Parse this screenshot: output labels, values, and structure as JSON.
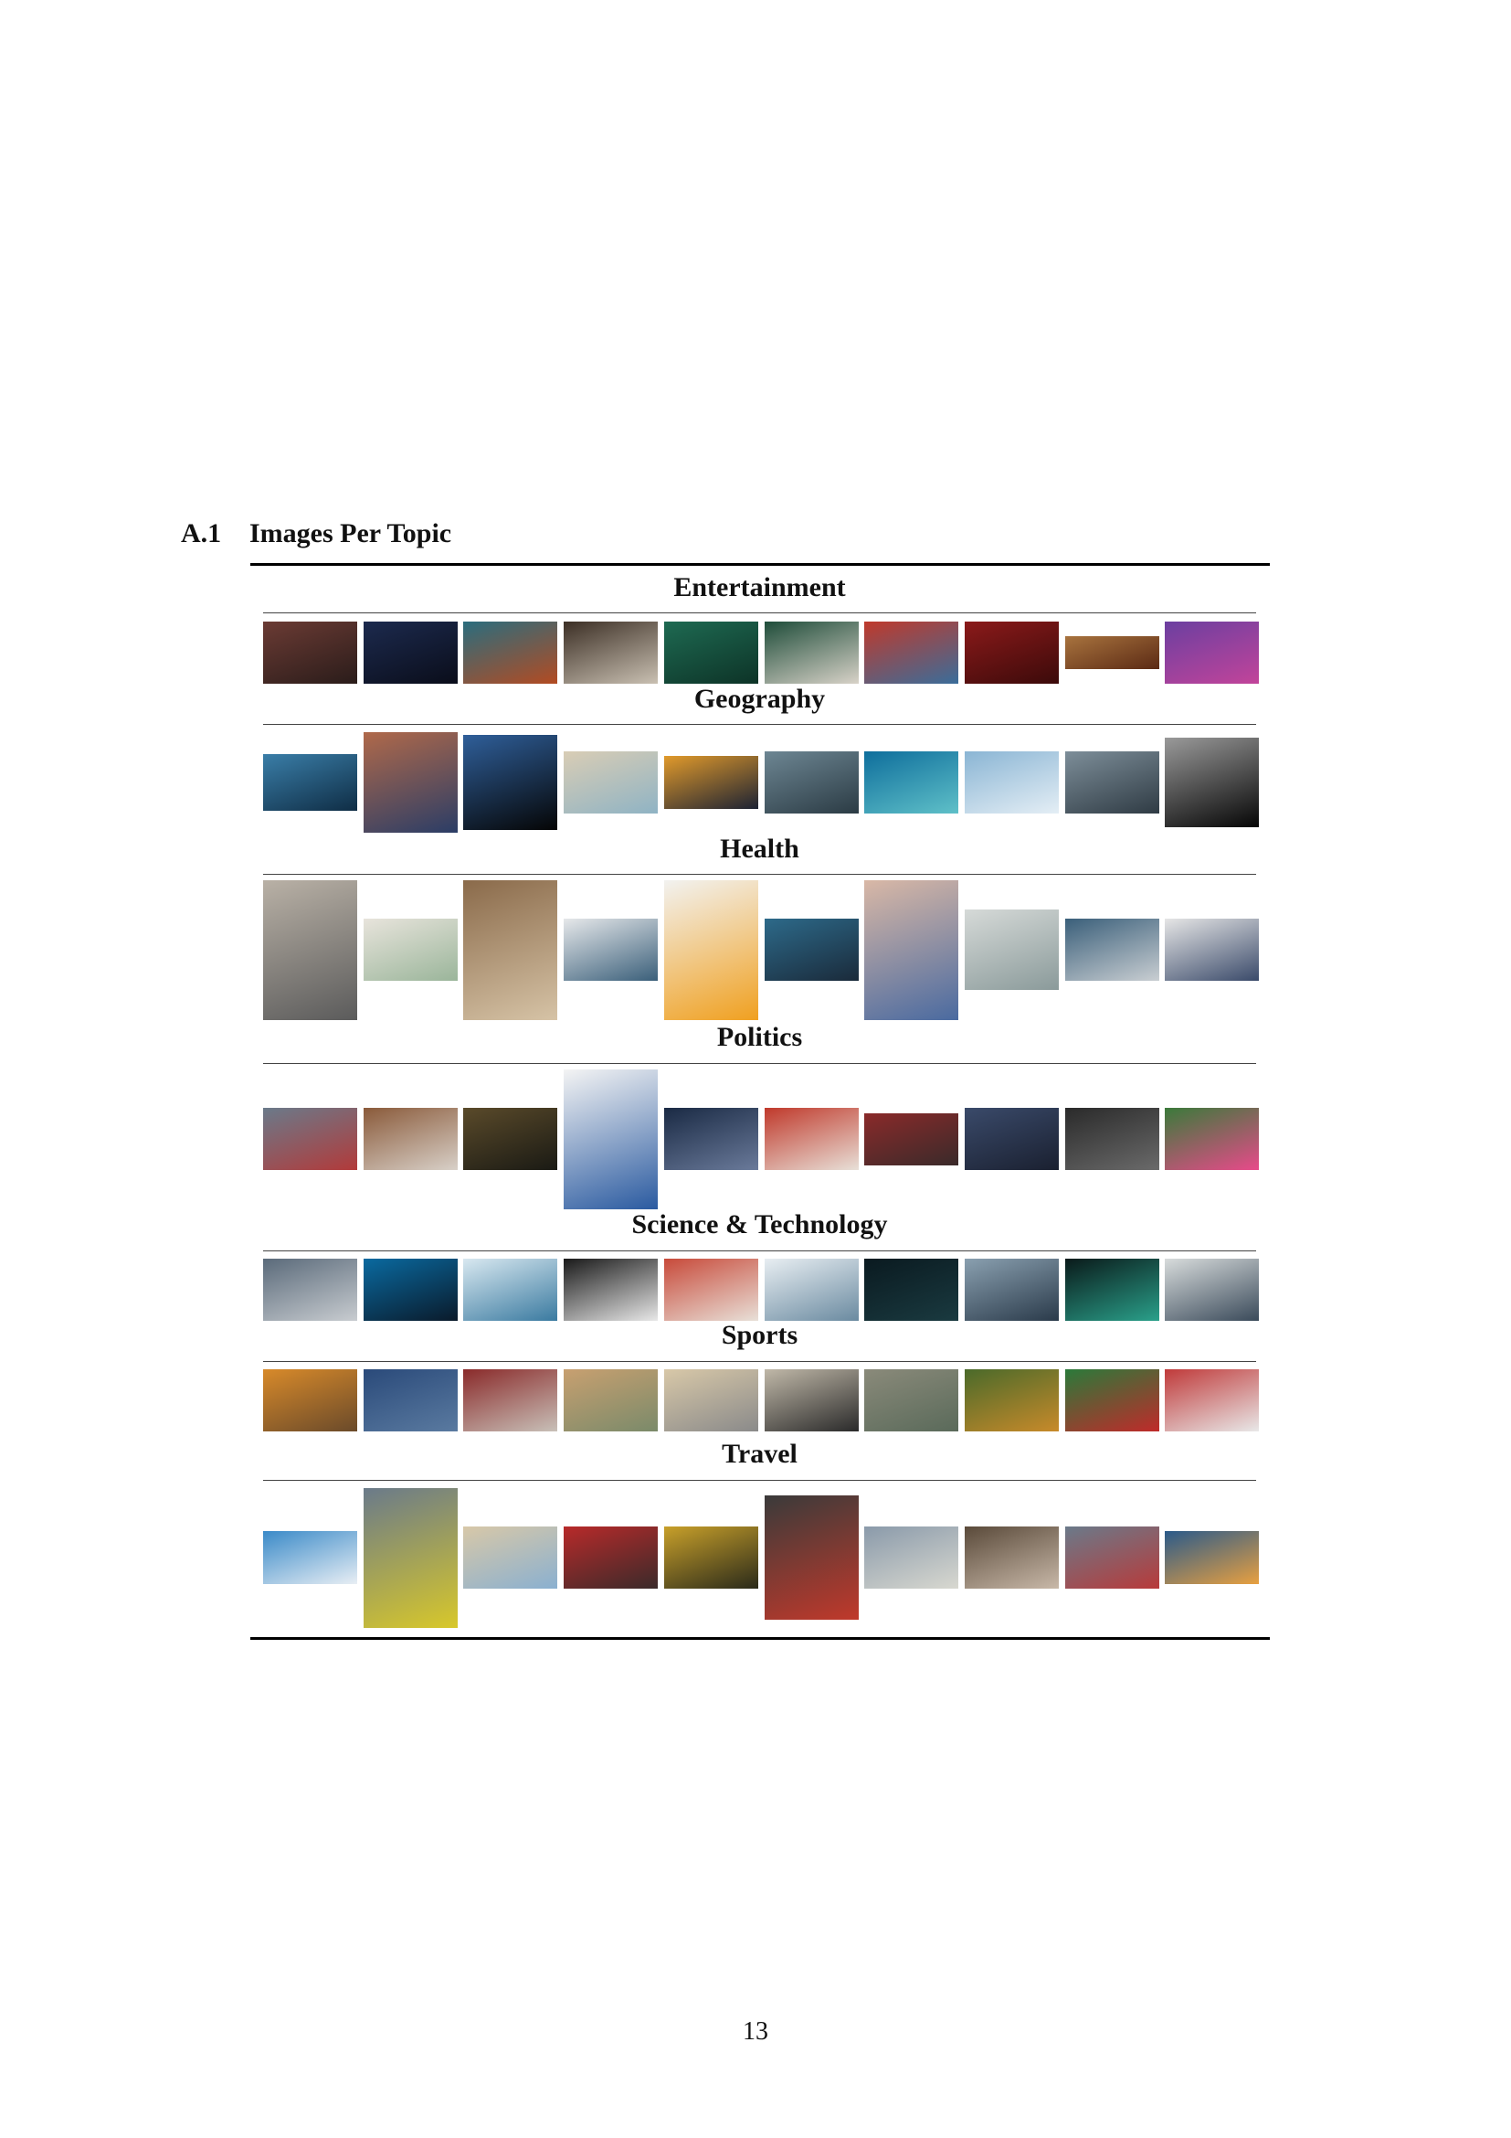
{
  "section": {
    "number": "A.1",
    "title": "Images Per Topic"
  },
  "topics": [
    {
      "title": "Entertainment",
      "images": [
        {
          "icon": "photo-crowd-hall",
          "c": [
            "#6b3b34",
            "#2a1c1a"
          ]
        },
        {
          "icon": "photo-concert-lights",
          "c": [
            "#1c2a4e",
            "#0a0d1a"
          ]
        },
        {
          "icon": "photo-swing-ride",
          "c": [
            "#2a6d7e",
            "#b34b22"
          ]
        },
        {
          "icon": "photo-chess-board",
          "c": [
            "#3c2f25",
            "#c9c0b2"
          ]
        },
        {
          "icon": "photo-poker-table",
          "c": [
            "#1e6a52",
            "#0d3327"
          ]
        },
        {
          "icon": "photo-card-game",
          "c": [
            "#1f4d3a",
            "#d8d2c8"
          ]
        },
        {
          "icon": "photo-festival-crowd",
          "c": [
            "#c0392b",
            "#3a6d9a"
          ]
        },
        {
          "icon": "photo-theater-seats",
          "c": [
            "#8b1a1a",
            "#3b0a0a"
          ]
        },
        {
          "icon": "photo-opera-house",
          "c": [
            "#a8733e",
            "#5b2a14"
          ]
        },
        {
          "icon": "photo-stage-performance",
          "c": [
            "#6b3fa0",
            "#c2449a"
          ]
        }
      ]
    },
    {
      "title": "Geography",
      "images": [
        {
          "icon": "photo-earth-from-space",
          "c": [
            "#3a7ea8",
            "#0f2d45"
          ]
        },
        {
          "icon": "photo-river-aerial",
          "c": [
            "#b0694a",
            "#2b3d66"
          ]
        },
        {
          "icon": "photo-globe-planet",
          "c": [
            "#2f5f9a",
            "#050505"
          ]
        },
        {
          "icon": "photo-paper-map",
          "c": [
            "#d9cdb5",
            "#8fb3c4"
          ]
        },
        {
          "icon": "photo-sunset-valley",
          "c": [
            "#e19a2b",
            "#1c2233"
          ]
        },
        {
          "icon": "photo-fjord-mountains",
          "c": [
            "#6d8693",
            "#2b3b44"
          ]
        },
        {
          "icon": "photo-tropical-atoll",
          "c": [
            "#0e6e9c",
            "#5fc0c8"
          ]
        },
        {
          "icon": "photo-iceberg",
          "c": [
            "#8ab5d4",
            "#e4eef5"
          ]
        },
        {
          "icon": "photo-cloudy-mountains",
          "c": [
            "#7d8e99",
            "#2f3b44"
          ]
        },
        {
          "icon": "photo-full-moon",
          "c": [
            "#9a9a9a",
            "#060606"
          ]
        }
      ]
    },
    {
      "title": "Health",
      "images": [
        {
          "icon": "photo-yoga-pose",
          "c": [
            "#b9b1a6",
            "#5b5b5b"
          ]
        },
        {
          "icon": "photo-bright-kitchen",
          "c": [
            "#e8e4dc",
            "#9ab59a"
          ]
        },
        {
          "icon": "photo-fruit-hands",
          "c": [
            "#8a6a4a",
            "#d6c3a6"
          ]
        },
        {
          "icon": "photo-stethoscope",
          "c": [
            "#e6e8ea",
            "#3a5f7a"
          ]
        },
        {
          "icon": "photo-thermometer-orange",
          "c": [
            "#f2f2f0",
            "#f0a020"
          ]
        },
        {
          "icon": "photo-doctor-patient",
          "c": [
            "#2d6a8a",
            "#1a2a3a"
          ]
        },
        {
          "icon": "photo-ultrasound",
          "c": [
            "#d9b8a6",
            "#4a6aa0"
          ]
        },
        {
          "icon": "photo-crutches",
          "c": [
            "#d6dad8",
            "#8a9a9a"
          ]
        },
        {
          "icon": "photo-ambulance",
          "c": [
            "#3a5f7a",
            "#c9ced2"
          ]
        },
        {
          "icon": "photo-eye-exam",
          "c": [
            "#e6e6e6",
            "#3a4a6a"
          ]
        }
      ]
    },
    {
      "title": "Politics",
      "images": [
        {
          "icon": "photo-un-flags",
          "c": [
            "#6a7a8a",
            "#b23a3a"
          ]
        },
        {
          "icon": "photo-parliament-hall",
          "c": [
            "#8a5a3a",
            "#d8d0c8"
          ]
        },
        {
          "icon": "photo-assembly-room",
          "c": [
            "#5a4a2a",
            "#1a1a14"
          ]
        },
        {
          "icon": "photo-vote-ballot-box",
          "c": [
            "#f4f4f4",
            "#2a5aa0"
          ]
        },
        {
          "icon": "photo-press-conference",
          "c": [
            "#1a2a44",
            "#6a7a9a"
          ]
        },
        {
          "icon": "photo-protest-signs",
          "c": [
            "#c0392b",
            "#e8e0d8"
          ]
        },
        {
          "icon": "photo-crowded-chamber",
          "c": [
            "#8a2a2a",
            "#3a2a2a"
          ]
        },
        {
          "icon": "photo-plenary-session",
          "c": [
            "#3a4a6a",
            "#1a2030"
          ]
        },
        {
          "icon": "photo-conference-hall",
          "c": [
            "#2a2a2a",
            "#6a6a6a"
          ]
        },
        {
          "icon": "photo-march-banner",
          "c": [
            "#3a7a3a",
            "#e84a8a"
          ]
        }
      ]
    },
    {
      "title": "Science & Technology",
      "images": [
        {
          "icon": "photo-lab-team",
          "c": [
            "#5a6a7a",
            "#c8ccd0"
          ]
        },
        {
          "icon": "photo-server-racks",
          "c": [
            "#0a6aa0",
            "#0a1a2a"
          ]
        },
        {
          "icon": "photo-microscope-lab",
          "c": [
            "#d8e8f0",
            "#3a7aa0"
          ]
        },
        {
          "icon": "photo-microscope-closeup",
          "c": [
            "#1a1a1a",
            "#e8e8e8"
          ]
        },
        {
          "icon": "photo-research-office",
          "c": [
            "#c84a3a",
            "#e8e0d8"
          ]
        },
        {
          "icon": "photo-clean-lab",
          "c": [
            "#e8eef2",
            "#6a8aa0"
          ]
        },
        {
          "icon": "photo-dark-datacenter",
          "c": [
            "#0a1a20",
            "#1a3a40"
          ]
        },
        {
          "icon": "photo-industrial-machine",
          "c": [
            "#8aa0b0",
            "#2a3a4a"
          ]
        },
        {
          "icon": "photo-fiber-cables",
          "c": [
            "#0a1a1a",
            "#2aa08a"
          ]
        },
        {
          "icon": "photo-network-cables",
          "c": [
            "#d8dcdc",
            "#3a4a5a"
          ]
        }
      ]
    },
    {
      "title": "Sports",
      "images": [
        {
          "icon": "photo-wheelchair-basketball",
          "c": [
            "#d88a2a",
            "#6a4a2a"
          ]
        },
        {
          "icon": "photo-kayak-sea",
          "c": [
            "#2a4a7a",
            "#5a7aa0"
          ]
        },
        {
          "icon": "photo-cycling-race",
          "c": [
            "#8a2a2a",
            "#c8c0b8"
          ]
        },
        {
          "icon": "photo-beach-football",
          "c": [
            "#c8a070",
            "#7a8a6a"
          ]
        },
        {
          "icon": "photo-dance-studio",
          "c": [
            "#d8c8a8",
            "#8a8a8a"
          ]
        },
        {
          "icon": "photo-sumo-ring",
          "c": [
            "#c0b8a8",
            "#2a2a2a"
          ]
        },
        {
          "icon": "photo-rock-climbing",
          "c": [
            "#8a8a7a",
            "#5a6a5a"
          ]
        },
        {
          "icon": "photo-soccer-match",
          "c": [
            "#4a6a2a",
            "#c88a2a"
          ]
        },
        {
          "icon": "photo-american-football",
          "c": [
            "#2a7a3a",
            "#c02a2a"
          ]
        },
        {
          "icon": "photo-running-track",
          "c": [
            "#c03a3a",
            "#e8e8e8"
          ]
        }
      ]
    },
    {
      "title": "Travel",
      "images": [
        {
          "icon": "photo-cruise-ship",
          "c": [
            "#3a8ac8",
            "#e8eef4"
          ]
        },
        {
          "icon": "photo-busy-street",
          "c": [
            "#6a7a8a",
            "#d8c82a"
          ]
        },
        {
          "icon": "photo-ancient-ruins",
          "c": [
            "#d8c8a8",
            "#8ab0d0"
          ]
        },
        {
          "icon": "photo-red-train",
          "c": [
            "#b82a2a",
            "#3a2a2a"
          ]
        },
        {
          "icon": "photo-station-platform",
          "c": [
            "#c8a02a",
            "#2a2a1a"
          ]
        },
        {
          "icon": "photo-backpack-luggage",
          "c": [
            "#3a3a3a",
            "#c0392b"
          ]
        },
        {
          "icon": "photo-city-street",
          "c": [
            "#8a9aaa",
            "#d8d8d0"
          ]
        },
        {
          "icon": "photo-airport-terminal",
          "c": [
            "#5a4a3a",
            "#c8b8a8"
          ]
        },
        {
          "icon": "photo-train-platform",
          "c": [
            "#6a7a8a",
            "#b83a3a"
          ]
        },
        {
          "icon": "photo-sunset-truck",
          "c": [
            "#2a5a8a",
            "#e8a040"
          ]
        }
      ]
    }
  ],
  "page_number": "13"
}
